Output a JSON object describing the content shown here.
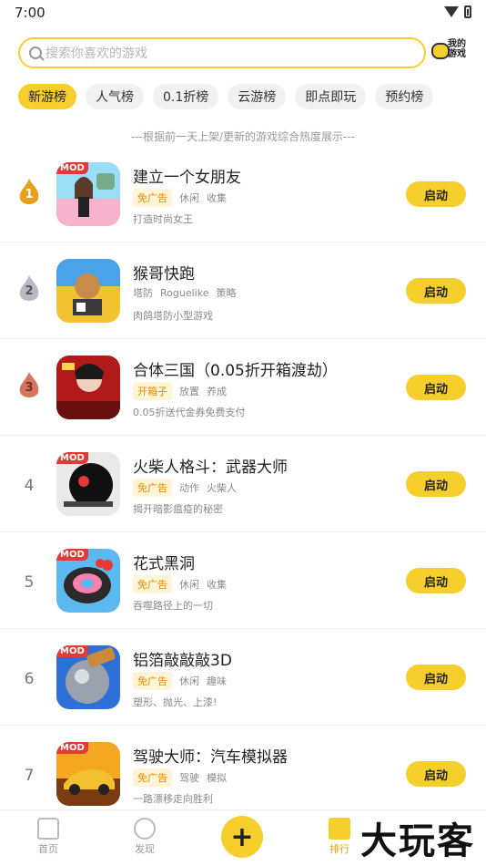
{
  "status": {
    "time": "7:00"
  },
  "search": {
    "placeholder": "搜索你喜欢的游戏",
    "my_games": "我的游戏"
  },
  "chips": [
    "新游榜",
    "人气榜",
    "0.1折榜",
    "云游榜",
    "即点即玩",
    "预约榜"
  ],
  "note": "---根据前一天上架/更新的游戏综合热度展示---",
  "games": [
    {
      "rank": "1",
      "name": "建立一个女朋友",
      "badge": "免广告",
      "tags": [
        "休闲",
        "收集"
      ],
      "desc": "打造时尚女王",
      "mod": "MOD",
      "button": "启动"
    },
    {
      "rank": "2",
      "name": "猴哥快跑",
      "badge": "",
      "tags": [
        "塔防",
        "Roguelike",
        "策略"
      ],
      "desc": "肉鸽塔防小型游戏",
      "mod": "",
      "button": "启动"
    },
    {
      "rank": "3",
      "name": "合体三国（0.05折开箱渡劫）",
      "badge": "开箱子",
      "tags": [
        "放置",
        "养成"
      ],
      "desc": "0.05折送代金券免费支付",
      "mod": "",
      "button": "启动"
    },
    {
      "rank": "4",
      "name": "火柴人格斗：武器大师",
      "badge": "免广告",
      "tags": [
        "动作",
        "火柴人"
      ],
      "desc": "揭开暗影瘟疫的秘密",
      "mod": "MOD",
      "button": "启动"
    },
    {
      "rank": "5",
      "name": "花式黑洞",
      "badge": "免广告",
      "tags": [
        "休闲",
        "收集"
      ],
      "desc": "吞噬路径上的一切",
      "mod": "MOD",
      "button": "启动"
    },
    {
      "rank": "6",
      "name": "铝箔敲敲敲3D",
      "badge": "免广告",
      "tags": [
        "休闲",
        "趣味"
      ],
      "desc": "塑形、抛光、上漆!",
      "mod": "MOD",
      "button": "启动"
    },
    {
      "rank": "7",
      "name": "驾驶大师：汽车模拟器",
      "badge": "免广告",
      "tags": [
        "驾驶",
        "模拟"
      ],
      "desc": "一路漂移走向胜利",
      "mod": "MOD",
      "button": "启动"
    }
  ],
  "nav": {
    "home": "首页",
    "discover": "发现",
    "plus": "+",
    "rank": "排行"
  },
  "watermark": "大玩客",
  "colors": {
    "accent": "#f7cf2d",
    "gold": "#e8a018",
    "silver": "#b9b9c4",
    "bronze": "#d2765d"
  }
}
